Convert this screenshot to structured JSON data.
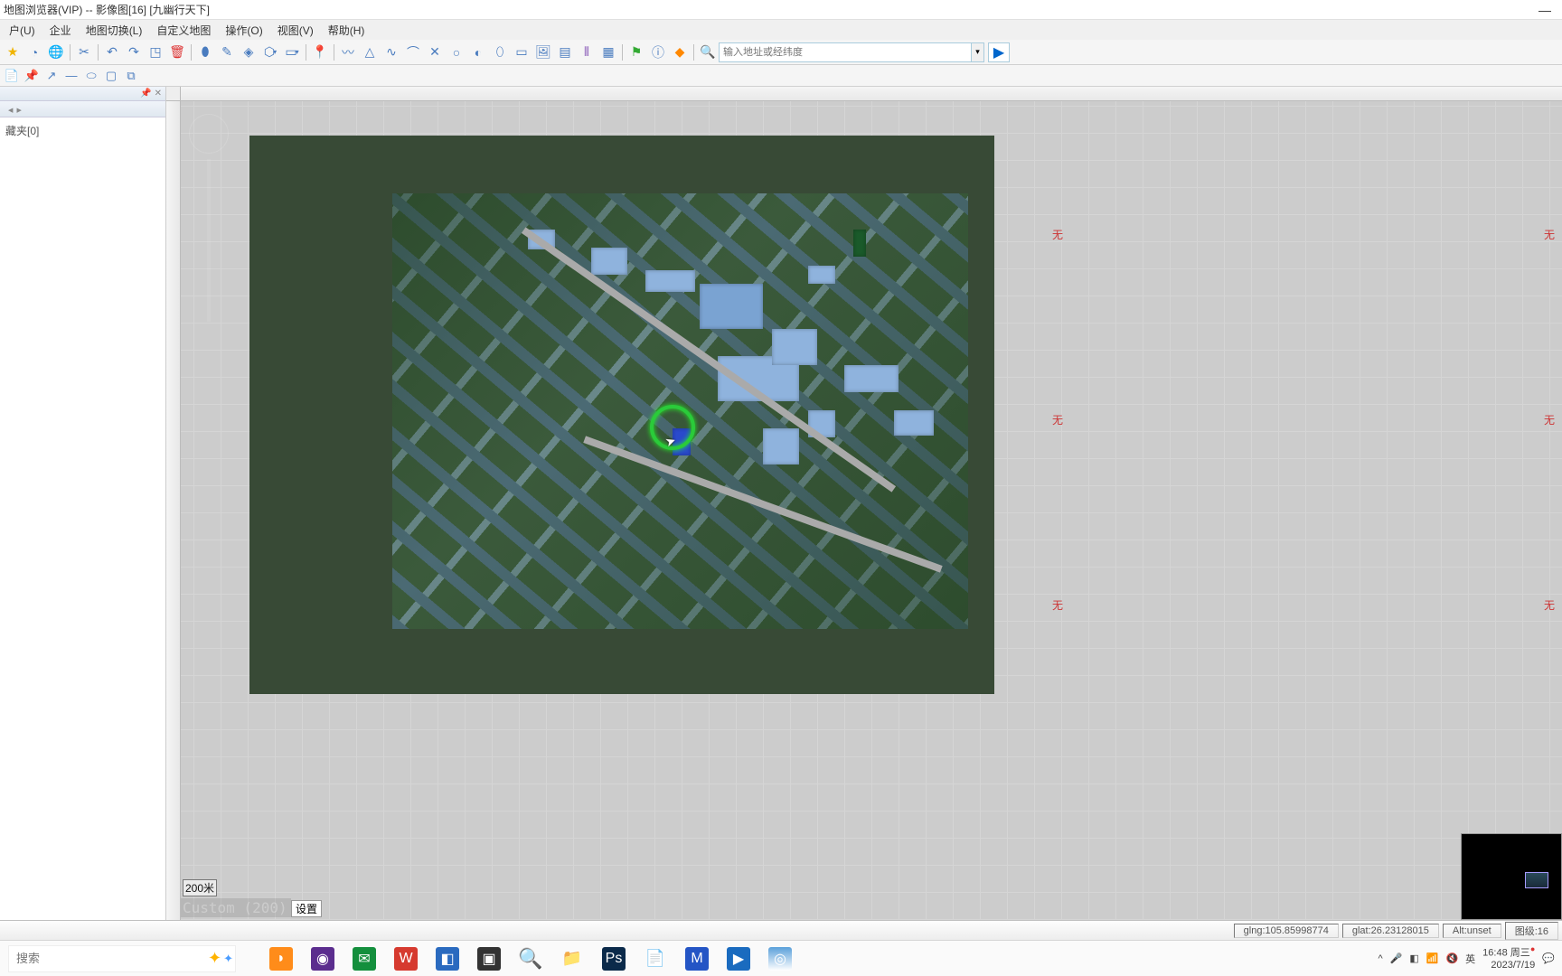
{
  "titlebar": {
    "text": "地图浏览器(VIP) -- 影像图[16] [九幽行天下]"
  },
  "menu": {
    "items": [
      "户(U)",
      "企业",
      "地图切换(L)",
      "自定义地图",
      "操作(O)",
      "视图(V)",
      "帮助(H)"
    ]
  },
  "search": {
    "placeholder": "输入地址或经纬度"
  },
  "sidebar": {
    "folder": "藏夹[0]"
  },
  "tiles": {
    "none": "无"
  },
  "scale": {
    "label": "200米"
  },
  "custom": {
    "label": "Custom (200)"
  },
  "settingsBtn": "设置",
  "status": {
    "lng": "glng:105.85998774",
    "lat": "glat:26.23128015",
    "alt": "Alt:unset",
    "level": "图级:16"
  },
  "taskbar": {
    "search": "搜索",
    "time": "16:48",
    "day": "周三",
    "date": "2023/7/19",
    "ime": "英"
  }
}
